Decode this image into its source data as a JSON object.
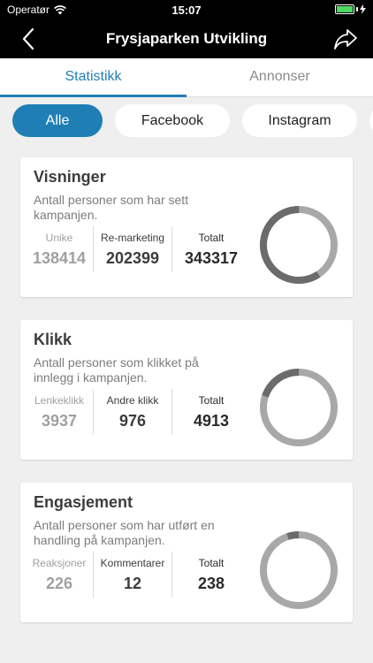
{
  "status_bar": {
    "carrier": "Operatør",
    "time": "15:07"
  },
  "nav": {
    "title": "Frysjaparken Utvikling",
    "back_icon": "chevron-left-icon",
    "share_icon": "share-arrow-icon"
  },
  "tabs": [
    {
      "label": "Statistikk",
      "active": true
    },
    {
      "label": "Annonser",
      "active": false
    }
  ],
  "filters": [
    {
      "label": "Alle",
      "active": true
    },
    {
      "label": "Facebook",
      "active": false
    },
    {
      "label": "Instagram",
      "active": false
    }
  ],
  "colors": {
    "accent": "#1f7fb5",
    "donut_dark": "#6b6b6b",
    "donut_light": "#a8a8a8"
  },
  "cards": [
    {
      "title": "Visninger",
      "description": "Antall personer som har sett kampanjen.",
      "stat1": {
        "label": "Unike",
        "value": "138414"
      },
      "stat2": {
        "label": "Re-marketing",
        "value": "202399"
      },
      "total": {
        "label": "Totalt",
        "value": "343317"
      },
      "segments": [
        138414,
        202399
      ]
    },
    {
      "title": "Klikk",
      "description": "Antall personer som klikket på innlegg i kampanjen.",
      "stat1": {
        "label": "Lenkeklikk",
        "value": "3937"
      },
      "stat2": {
        "label": "Andre klikk",
        "value": "976"
      },
      "total": {
        "label": "Totalt",
        "value": "4913"
      },
      "segments": [
        3937,
        976
      ]
    },
    {
      "title": "Engasjement",
      "description": "Antall personer som har utført en handling på kampanjen.",
      "stat1": {
        "label": "Reaksjoner",
        "value": "226"
      },
      "stat2": {
        "label": "Kommentarer",
        "value": "12"
      },
      "total": {
        "label": "Totalt",
        "value": "238"
      },
      "segments": [
        226,
        12
      ]
    }
  ]
}
